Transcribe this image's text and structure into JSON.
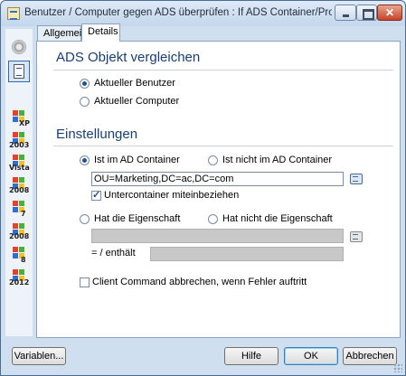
{
  "window": {
    "title": "Benutzer / Computer gegen ADS überprüfen : If ADS Container/Property matc..."
  },
  "sidebar": {
    "icons": [
      "settings-circle-icon",
      "list-details-icon"
    ],
    "os_items": [
      {
        "label": "XP"
      },
      {
        "label": "2003"
      },
      {
        "label": "Vista"
      },
      {
        "label": "2008"
      },
      {
        "label": "7"
      },
      {
        "label": "2008"
      },
      {
        "label": "8"
      },
      {
        "label": "2012"
      }
    ]
  },
  "tabs": [
    {
      "label": "Allgemein"
    },
    {
      "label": "Details"
    }
  ],
  "ads_section": {
    "title": "ADS Objekt vergleichen",
    "options": [
      {
        "label": "Aktueller Benutzer",
        "checked": true
      },
      {
        "label": "Aktueller Computer",
        "checked": false
      }
    ]
  },
  "settings_section": {
    "title": "Einstellungen",
    "container_radio_in": {
      "label": "Ist im AD Container",
      "checked": true
    },
    "container_radio_not_in": {
      "label": "Ist nicht im AD Container",
      "checked": false
    },
    "container_value": "OU=Marketing,DC=ac,DC=com",
    "include_subcontainers": {
      "label": "Untercontainer miteinbeziehen",
      "checked": true
    },
    "property_radio_has": {
      "label": "Hat die Eigenschaft",
      "checked": false
    },
    "property_radio_has_not": {
      "label": "Hat nicht die Eigenschaft",
      "checked": false
    },
    "property_value": "",
    "equals_label": "= / enthält",
    "equals_value": "",
    "abort_on_error": {
      "label": "Client Command abbrechen, wenn Fehler auftritt",
      "checked": false
    }
  },
  "footer": {
    "variables_button": "Variablen...",
    "help_button": "Hilfe",
    "ok_button": "OK",
    "cancel_button": "Abbrechen"
  },
  "colors": {
    "frame": "#cfdff0",
    "section_title": "#1a3e72",
    "panel": "#ffffff"
  }
}
